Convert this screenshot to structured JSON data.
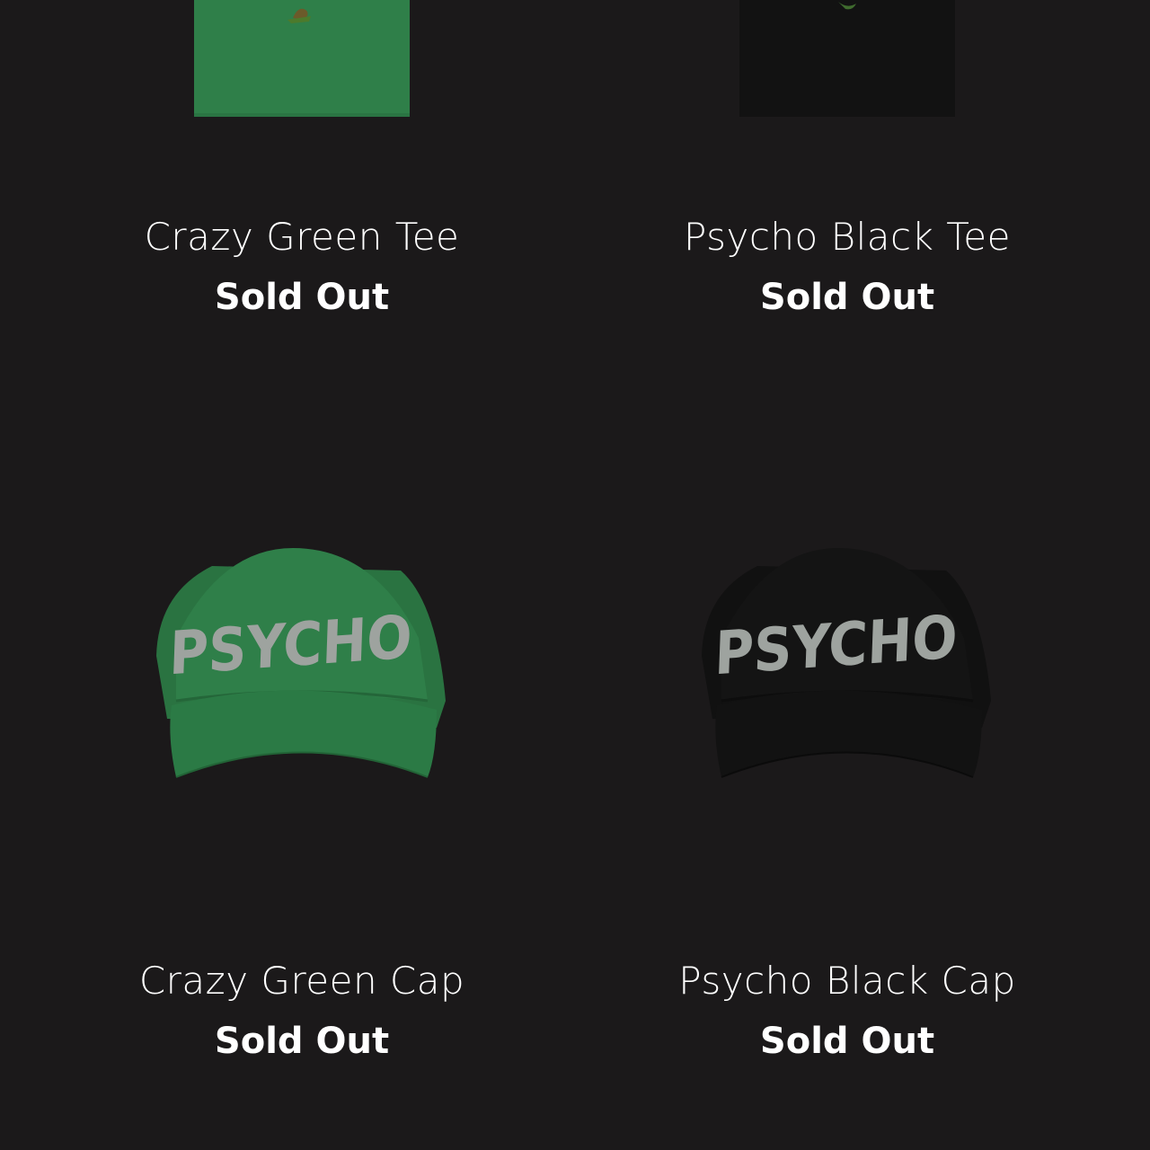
{
  "products": [
    {
      "title": "Crazy Green Tee",
      "status": "Sold Out",
      "image": "green-tee-image",
      "color": "#2f7f49"
    },
    {
      "title": "Psycho Black Tee",
      "status": "Sold Out",
      "image": "black-tee-image",
      "color": "#121212"
    },
    {
      "title": "Crazy Green Cap",
      "status": "Sold Out",
      "image": "green-cap-image",
      "color": "#2e7c45",
      "cap_text": "PSYCHO"
    },
    {
      "title": "Psycho Black Cap",
      "status": "Sold Out",
      "image": "black-cap-image",
      "color": "#141414",
      "cap_text": "PSYCHO"
    }
  ],
  "colors": {
    "background": "#1b191a",
    "text": "#ffffff",
    "cap_lettering": "#9ea39f"
  }
}
